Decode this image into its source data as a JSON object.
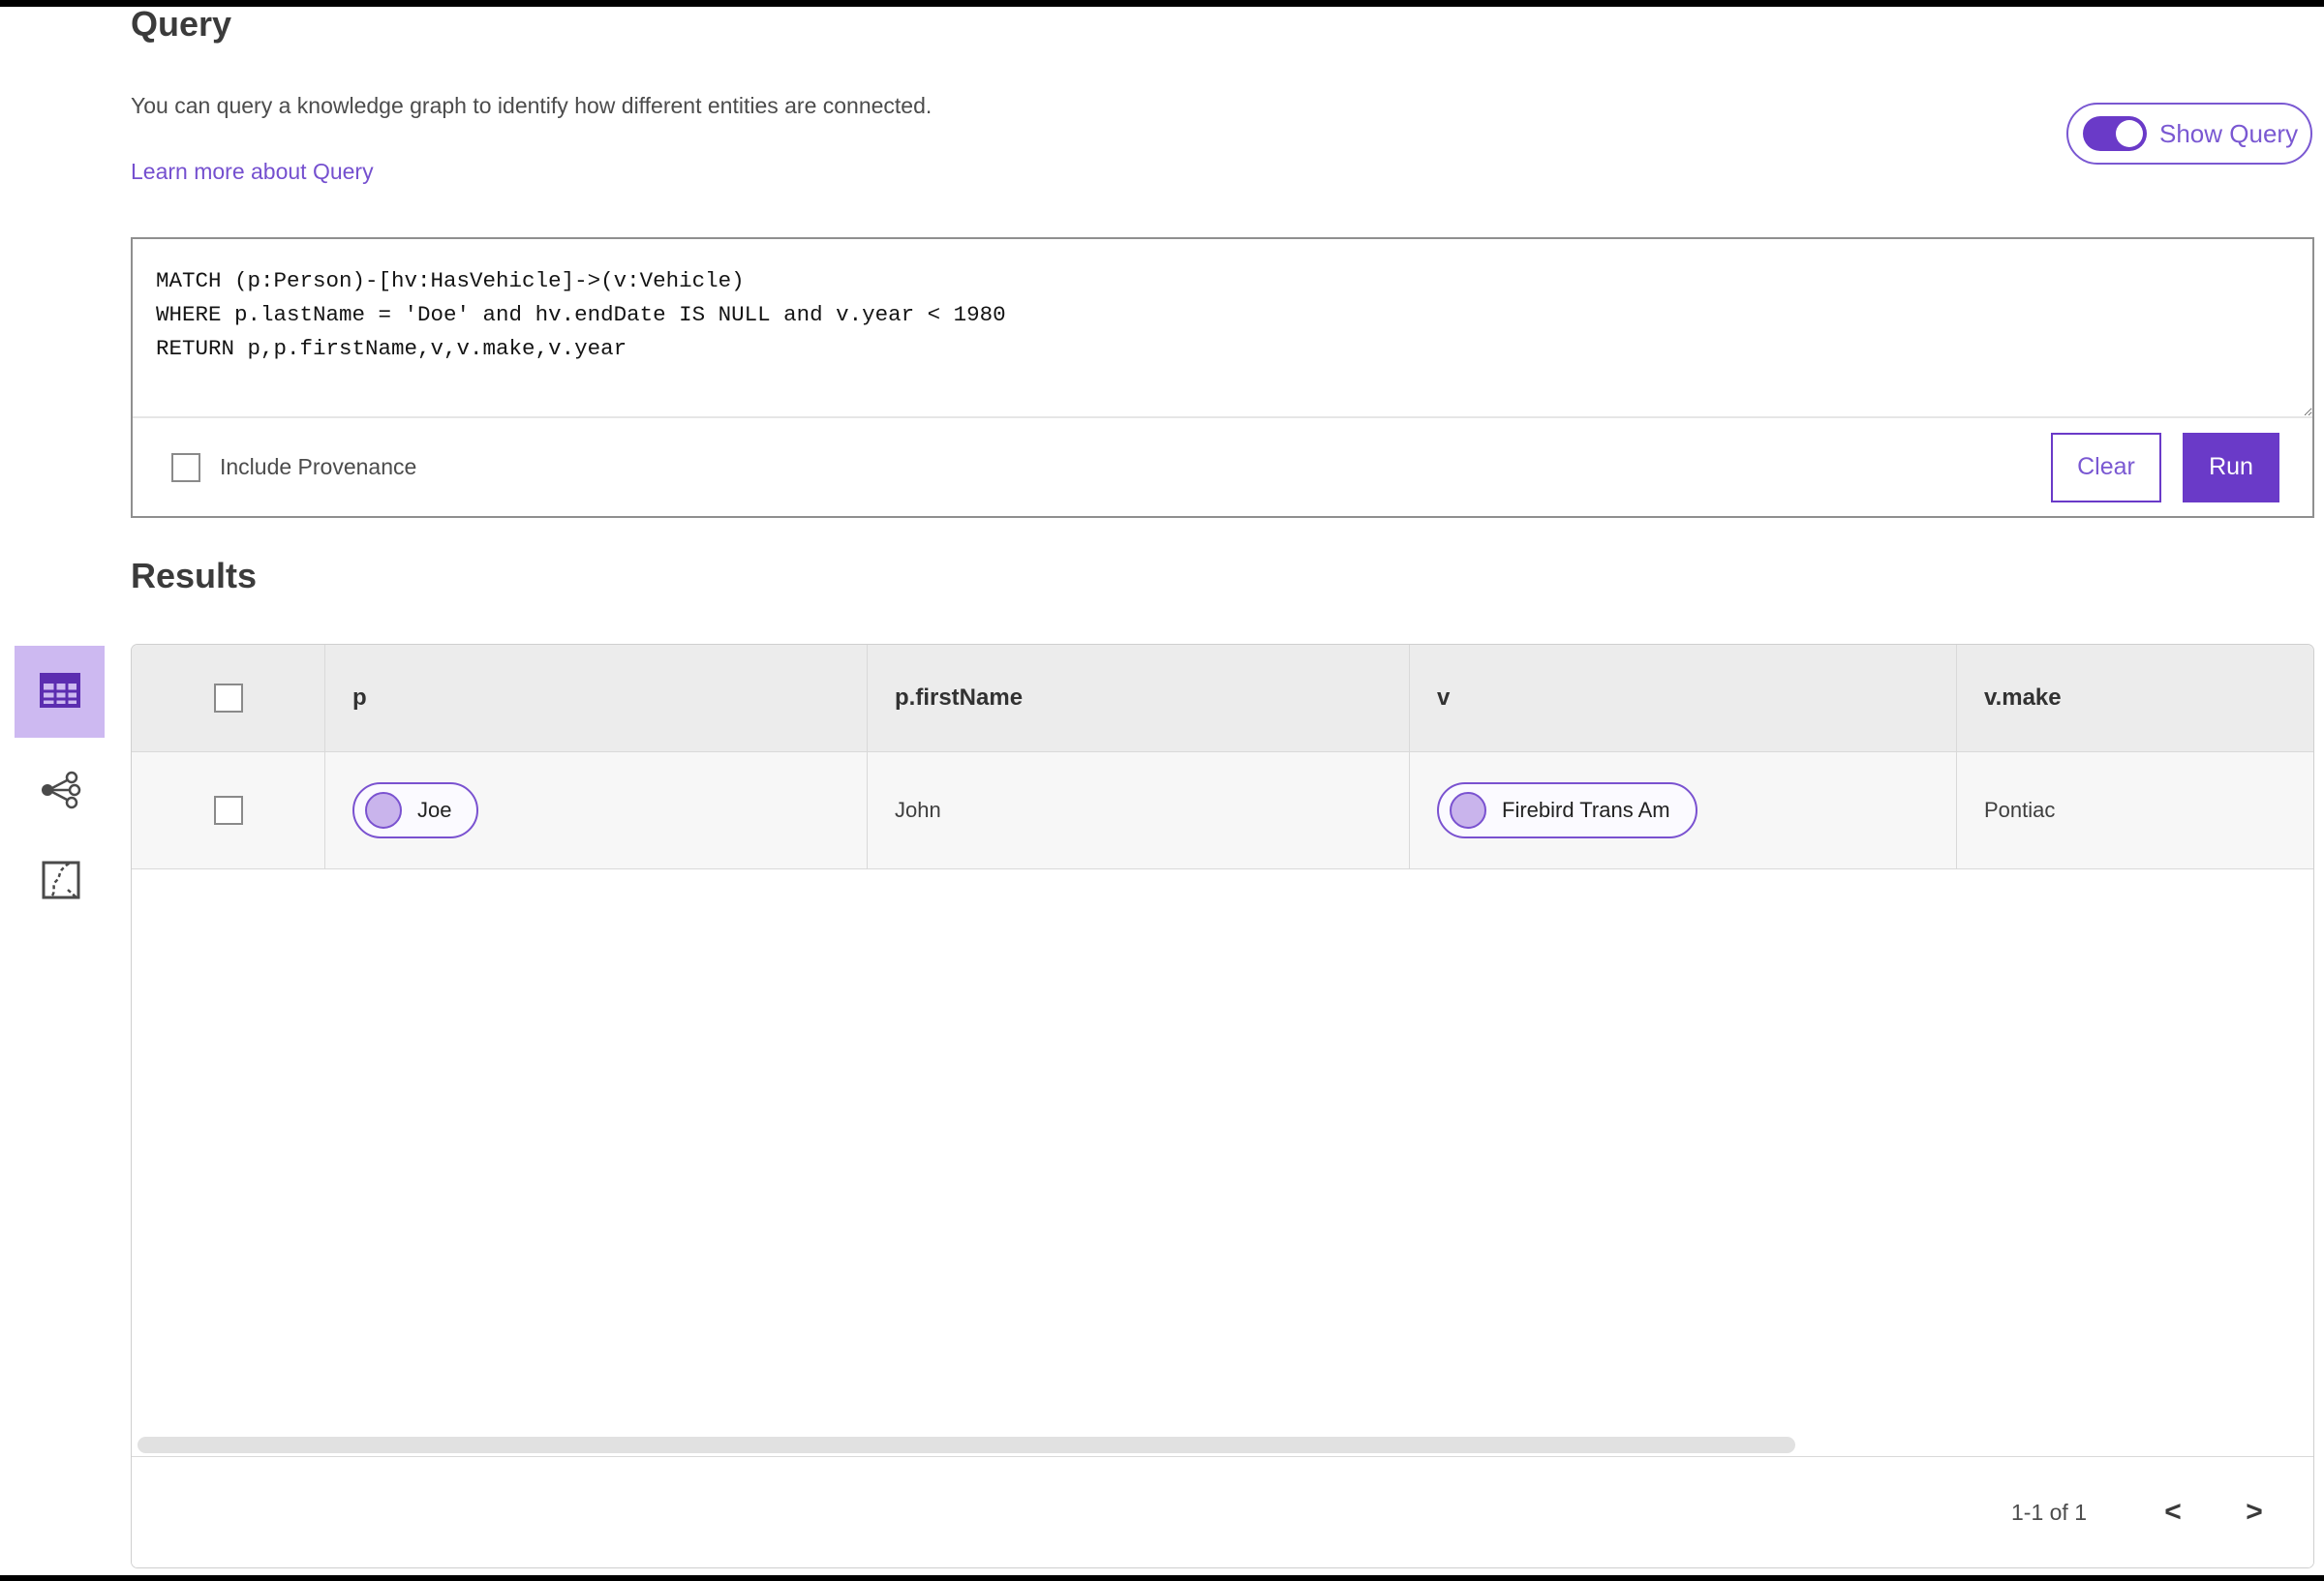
{
  "page": {
    "title": "Query",
    "description": "You can query a knowledge graph to identify how different entities are connected.",
    "learn_more": "Learn more about Query",
    "show_query_label": "Show Query",
    "show_query_on": true,
    "results_title": "Results"
  },
  "query_editor": {
    "text": "MATCH (p:Person)-[hv:HasVehicle]->(v:Vehicle)\nWHERE p.lastName = 'Doe' and hv.endDate IS NULL and v.year < 1980\nRETURN p,p.firstName,v,v.make,v.year",
    "include_provenance_label": "Include Provenance",
    "include_provenance_checked": false,
    "clear_label": "Clear",
    "run_label": "Run"
  },
  "view_switcher": {
    "items": [
      {
        "name": "table-view",
        "icon": "table-icon",
        "active": true
      },
      {
        "name": "link-chart-view",
        "icon": "link-chart-icon",
        "active": false
      },
      {
        "name": "map-view",
        "icon": "map-icon",
        "active": false
      }
    ]
  },
  "results_table": {
    "columns": [
      "p",
      "p.firstName",
      "v",
      "v.make"
    ],
    "rows": [
      {
        "p_label": "Joe",
        "p_firstName": "John",
        "v_label": "Firebird Trans Am",
        "v_make": "Pontiac"
      }
    ],
    "pagination": {
      "label": "1-1 of 1",
      "prev_icon": "<",
      "next_icon": ">"
    }
  },
  "colors": {
    "accent_purple": "#6a3ac8",
    "accent_purple_light": "#cdb9f1",
    "link_purple": "#7550cf",
    "pill_border": "#7a52d0",
    "pill_dot_fill": "#c9b4ec",
    "header_row_bg": "#ececec",
    "data_row_bg": "#f7f7f7",
    "heading_text": "#3b3b3b"
  }
}
